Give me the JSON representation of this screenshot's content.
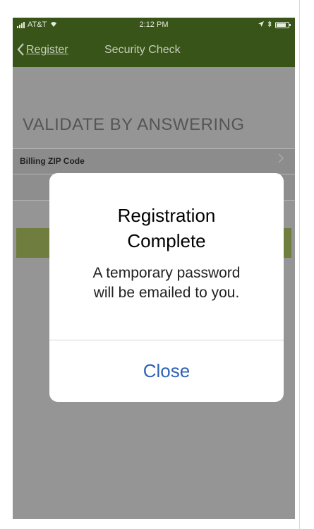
{
  "status_bar": {
    "carrier": "AT&T",
    "time": "2:12 PM",
    "wifi_icon": "wifi-icon",
    "battery_icon": "battery-icon"
  },
  "nav": {
    "back_label": "Register",
    "back_icon": "chevron-left-icon",
    "title": "Security Check"
  },
  "form": {
    "section_header": "VALIDATE BY ANSWERING",
    "rows": [
      {
        "label": "Billing ZIP Code"
      }
    ]
  },
  "alert": {
    "title_lines": [
      "Registration",
      "Complete"
    ],
    "message_lines": [
      "A temporary password",
      "will be emailed to you."
    ],
    "close_label": "Close"
  },
  "colors": {
    "navbar": "#385418",
    "alert_button": "#2f63b6",
    "backdrop": "#959595"
  }
}
